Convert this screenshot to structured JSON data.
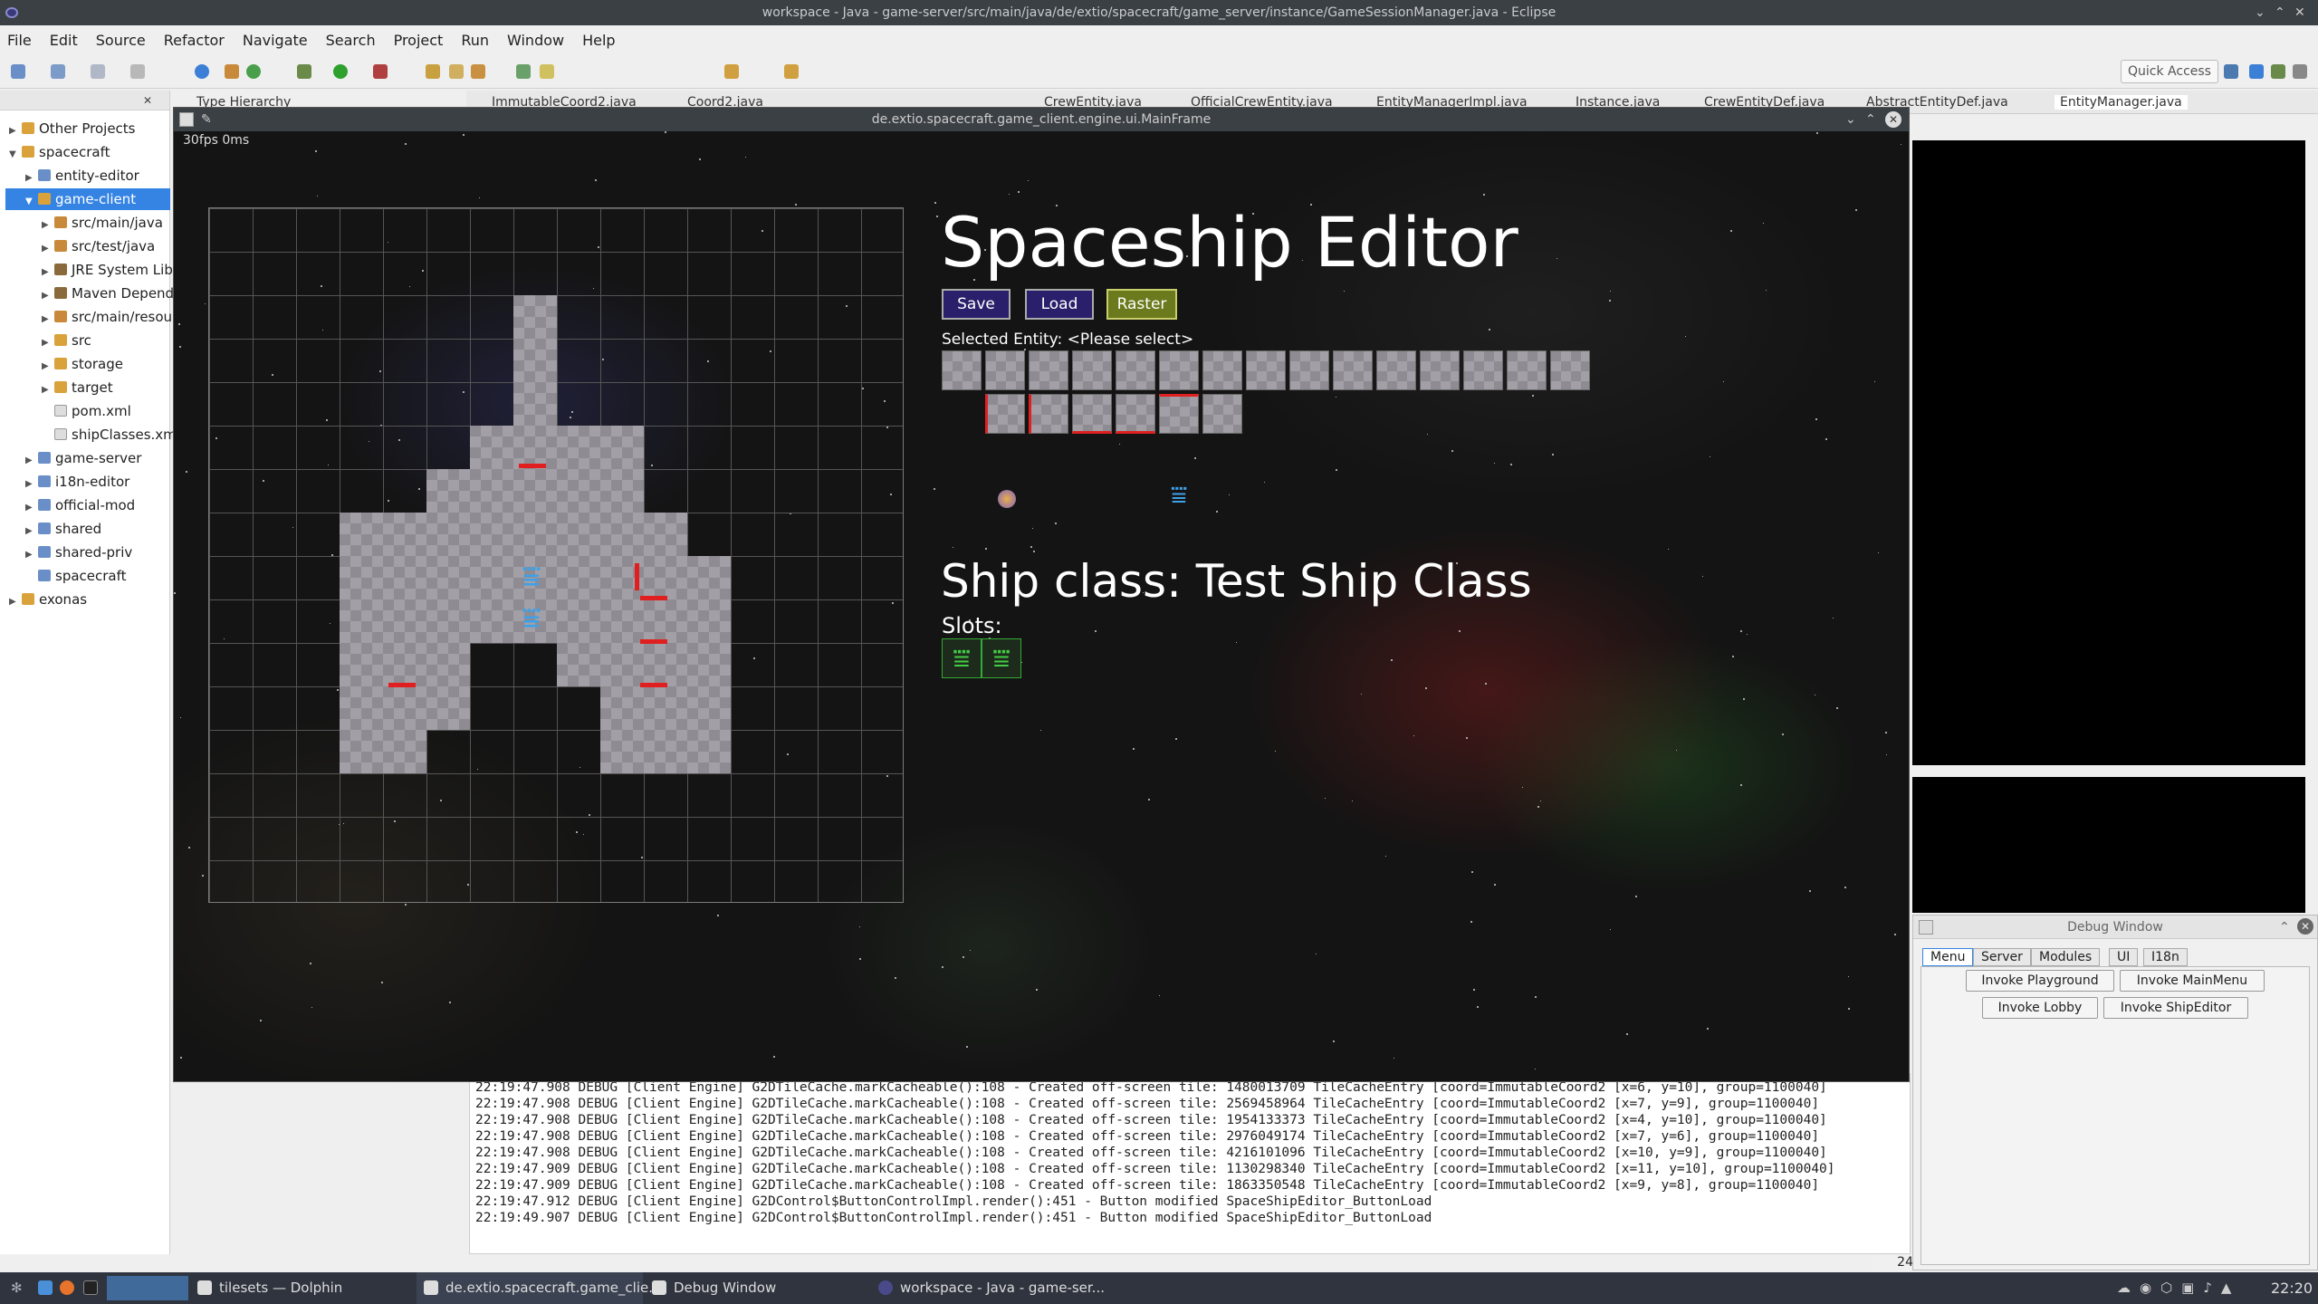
{
  "eclipse": {
    "window_title": "workspace - Java - game-server/src/main/java/de/extio/spacecraft/game_server/instance/GameSessionManager.java - Eclipse",
    "menu": [
      "File",
      "Edit",
      "Source",
      "Refactor",
      "Navigate",
      "Search",
      "Project",
      "Run",
      "Window",
      "Help"
    ],
    "quick_access": "Quick Access",
    "editor_tabs": [
      "Type Hierarchy",
      "ImmutableCoord2.java",
      "Coord2.java",
      "CrewEntity.java",
      "OfficialCrewEntity.java",
      "EntityManagerImpl.java",
      "Instance.java",
      "CrewEntityDef.java",
      "AbstractEntityDef.java",
      "EntityManager.java"
    ],
    "explorer": [
      {
        "label": "Other Projects",
        "icon": "folder-icon"
      },
      {
        "label": "spacecraft",
        "icon": "project-icon"
      },
      {
        "label": "entity-editor",
        "icon": "project-icon"
      },
      {
        "label": "game-client",
        "icon": "project-icon"
      },
      {
        "label": "src/main/java",
        "icon": "package-folder-icon"
      },
      {
        "label": "src/test/java",
        "icon": "package-folder-icon"
      },
      {
        "label": "JRE System Libr",
        "icon": "library-icon"
      },
      {
        "label": "Maven Depend",
        "icon": "library-icon"
      },
      {
        "label": "src/main/resou",
        "icon": "package-folder-icon"
      },
      {
        "label": "src",
        "icon": "folder-icon"
      },
      {
        "label": "storage",
        "icon": "folder-icon"
      },
      {
        "label": "target",
        "icon": "folder-icon"
      },
      {
        "label": "pom.xml",
        "icon": "xml-file-icon"
      },
      {
        "label": "shipClasses.xml",
        "icon": "xml-file-icon"
      },
      {
        "label": "game-server",
        "icon": "project-icon"
      },
      {
        "label": "i18n-editor",
        "icon": "project-icon"
      },
      {
        "label": "official-mod",
        "icon": "project-icon"
      },
      {
        "label": "shared",
        "icon": "project-icon"
      },
      {
        "label": "shared-priv",
        "icon": "project-icon"
      },
      {
        "label": "spacecraft",
        "icon": "project-icon"
      },
      {
        "label": "exonas",
        "icon": "folder-icon"
      }
    ],
    "console_lines": [
      "22:19:47.908 DEBUG [Client Engine] G2DTileCache.markCacheable():108 - Created off-screen tile: 1480013709 TileCacheEntry [coord=ImmutableCoord2 [x=6, y=10], group=1100040]",
      "22:19:47.908 DEBUG [Client Engine] G2DTileCache.markCacheable():108 - Created off-screen tile: 2569458964 TileCacheEntry [coord=ImmutableCoord2 [x=7, y=9], group=1100040]",
      "22:19:47.908 DEBUG [Client Engine] G2DTileCache.markCacheable():108 - Created off-screen tile: 1954133373 TileCacheEntry [coord=ImmutableCoord2 [x=4, y=10], group=1100040]",
      "22:19:47.908 DEBUG [Client Engine] G2DTileCache.markCacheable():108 - Created off-screen tile: 2976049174 TileCacheEntry [coord=ImmutableCoord2 [x=7, y=6], group=1100040]",
      "22:19:47.908 DEBUG [Client Engine] G2DTileCache.markCacheable():108 - Created off-screen tile: 4216101096 TileCacheEntry [coord=ImmutableCoord2 [x=10, y=9], group=1100040]",
      "22:19:47.909 DEBUG [Client Engine] G2DTileCache.markCacheable():108 - Created off-screen tile: 1130298340 TileCacheEntry [coord=ImmutableCoord2 [x=11, y=10], group=1100040]",
      "22:19:47.909 DEBUG [Client Engine] G2DTileCache.markCacheable():108 - Created off-screen tile: 1863350548 TileCacheEntry [coord=ImmutableCoord2 [x=9, y=8], group=1100040]",
      "22:19:47.912 DEBUG [Client Engine] G2DControl$ButtonControlImpl.render():451 - Button modified SpaceShipEditor_ButtonLoad",
      "22:19:49.907 DEBUG [Client Engine] G2DControl$ButtonControlImpl.render():451 - Button modified SpaceShipEditor_ButtonLoad"
    ],
    "line_count": "24"
  },
  "game": {
    "window_title": "de.extio.spacecraft.game_client.engine.ui.MainFrame",
    "fps": "30fps 0ms",
    "editor_title": "Spaceship Editor",
    "buttons": {
      "save": "Save",
      "load": "Load",
      "raster": "Raster"
    },
    "selected_entity": "Selected Entity: <Please select>",
    "ship_class": "Ship class: Test Ship Class",
    "slots_label": "Slots:"
  },
  "debug": {
    "title": "Debug Window",
    "tabs": [
      "Menu",
      "Server",
      "Modules",
      "UI",
      "I18n"
    ],
    "buttons": [
      "Invoke Playground",
      "Invoke MainMenu",
      "Invoke Lobby",
      "Invoke ShipEditor"
    ]
  },
  "taskbar": {
    "items": [
      "tilesets — Dolphin",
      "de.extio.spacecraft.game_clie...",
      "Debug Window",
      "workspace - Java - game-ser..."
    ],
    "clock": "22:20"
  },
  "colors": {
    "accent": "#3584e4",
    "door": "#e02020",
    "slot_green": "#44cc44",
    "button_blue": "#2a1f6a",
    "raster_olive": "#6b7a1c"
  }
}
